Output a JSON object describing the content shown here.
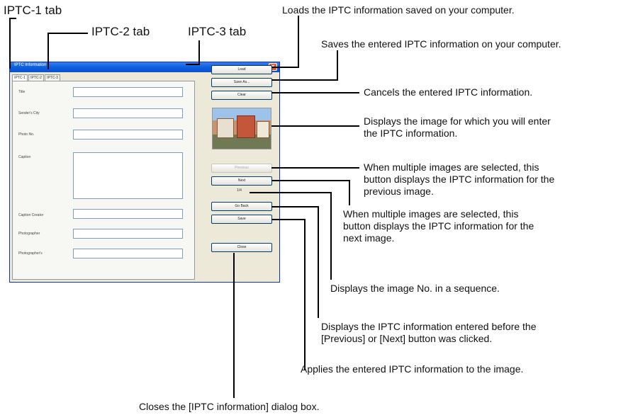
{
  "callouts": {
    "tab1": "IPTC-1 tab",
    "tab2": "IPTC-2 tab",
    "tab3": "IPTC-3 tab",
    "load": "Loads the IPTC information saved on your computer.",
    "save_as": "Saves the entered IPTC information on your computer.",
    "clear": "Cancels the entered IPTC information.",
    "image": [
      "Displays the image for which you will enter",
      "the IPTC information."
    ],
    "previous": [
      "When multiple images are selected, this",
      "button displays the IPTC information for the",
      "previous image."
    ],
    "next": [
      "When multiple images are selected, this",
      "button displays the IPTC information for the",
      "next image."
    ],
    "sequence": "Displays the image No. in a sequence.",
    "go_back": [
      "Displays the IPTC information entered before the",
      "[Previous] or [Next] button was clicked."
    ],
    "apply": "Applies the entered IPTC information to the image.",
    "close": "Closes the [IPTC information] dialog box."
  },
  "dialog": {
    "title": "IPTC Information",
    "close_glyph": "✕",
    "tabs": [
      "IPTC-1",
      "IPTC-2",
      "IPTC-3"
    ],
    "fields": [
      "Title",
      "Sender's City",
      "Photo No.",
      "Caption",
      "Caption Creator",
      "Photographer",
      "Photographer's"
    ],
    "buttons": {
      "load": "Load",
      "save_as": "Save As...",
      "clear": "Clear",
      "previous": "Previous",
      "next": "Next",
      "go_back": "Go Back",
      "save": "Save",
      "close": "Close"
    },
    "sequence": "1/4"
  }
}
